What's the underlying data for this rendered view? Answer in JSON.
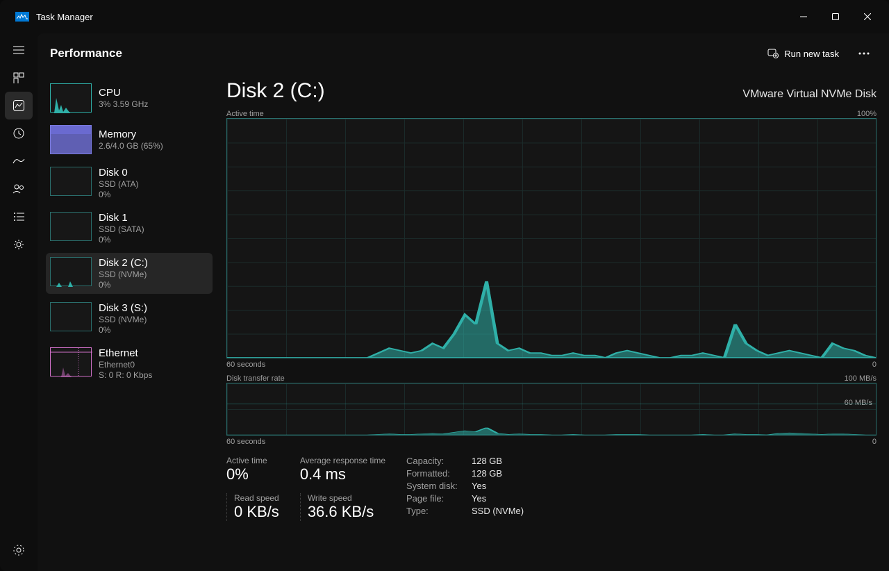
{
  "window": {
    "title": "Task Manager"
  },
  "header": {
    "page_title": "Performance",
    "run_task_label": "Run new task"
  },
  "resources": [
    {
      "title": "CPU",
      "sub1": "3%  3.59 GHz",
      "sub2": "",
      "color": "#2fb0a8",
      "thumb": "cpu"
    },
    {
      "title": "Memory",
      "sub1": "2.6/4.0 GB (65%)",
      "sub2": "",
      "color": "#7a7ae0",
      "thumb": "memory"
    },
    {
      "title": "Disk 0",
      "sub1": "SSD (ATA)",
      "sub2": "0%",
      "color": "#2a6e6c",
      "thumb": "disk"
    },
    {
      "title": "Disk 1",
      "sub1": "SSD (SATA)",
      "sub2": "0%",
      "color": "#2a6e6c",
      "thumb": "disk"
    },
    {
      "title": "Disk 2 (C:)",
      "sub1": "SSD (NVMe)",
      "sub2": "0%",
      "color": "#2a6e6c",
      "thumb": "disk2",
      "selected": true
    },
    {
      "title": "Disk 3 (S:)",
      "sub1": "SSD (NVMe)",
      "sub2": "0%",
      "color": "#2a6e6c",
      "thumb": "disk"
    },
    {
      "title": "Ethernet",
      "sub1": "Ethernet0",
      "sub2": "S: 0 R: 0 Kbps",
      "color": "#d070c8",
      "thumb": "ethernet"
    }
  ],
  "detail": {
    "title": "Disk 2 (C:)",
    "model": "VMware Virtual NVMe Disk",
    "chart1_label": "Active time",
    "chart1_max": "100%",
    "chart1_timerange": "60 seconds",
    "chart1_end": "0",
    "chart2_label": "Disk transfer rate",
    "chart2_max": "100 MB/s",
    "chart2_line": "60 MB/s",
    "stats": {
      "active_time_label": "Active time",
      "active_time_value": "0%",
      "avg_resp_label": "Average response time",
      "avg_resp_value": "0.4 ms",
      "read_label": "Read speed",
      "read_value": "0 KB/s",
      "write_label": "Write speed",
      "write_value": "36.6 KB/s"
    },
    "info": {
      "capacity_k": "Capacity:",
      "capacity_v": "128 GB",
      "formatted_k": "Formatted:",
      "formatted_v": "128 GB",
      "sysdisk_k": "System disk:",
      "sysdisk_v": "Yes",
      "pagefile_k": "Page file:",
      "pagefile_v": "Yes",
      "type_k": "Type:",
      "type_v": "SSD (NVMe)"
    }
  },
  "chart_data": [
    {
      "type": "area",
      "title": "Active time",
      "ylabel": "%",
      "ylim": [
        0,
        100
      ],
      "xlabel": "seconds",
      "xlim": [
        60,
        0
      ],
      "series": [
        {
          "name": "Active time %",
          "color": "#2fb0a8",
          "values": [
            0,
            0,
            0,
            0,
            0,
            0,
            0,
            0,
            0,
            0,
            0,
            0,
            0,
            0,
            2,
            4,
            3,
            2,
            3,
            6,
            4,
            10,
            18,
            14,
            32,
            6,
            3,
            4,
            2,
            2,
            1,
            1,
            2,
            1,
            1,
            0,
            2,
            3,
            2,
            1,
            0,
            0,
            1,
            1,
            2,
            1,
            0,
            14,
            6,
            3,
            1,
            2,
            3,
            2,
            1,
            0,
            6,
            4,
            3,
            1,
            0
          ]
        }
      ]
    },
    {
      "type": "area",
      "title": "Disk transfer rate",
      "ylabel": "MB/s",
      "ylim": [
        0,
        100
      ],
      "gridlines": [
        60
      ],
      "xlabel": "seconds",
      "xlim": [
        60,
        0
      ],
      "series": [
        {
          "name": "Write",
          "color": "#2fb0a8",
          "values": [
            0,
            0,
            0,
            0,
            0,
            0,
            0,
            0,
            0,
            0,
            0,
            0,
            0,
            0,
            1,
            2,
            1,
            1,
            2,
            3,
            2,
            5,
            8,
            6,
            14,
            3,
            1,
            2,
            1,
            1,
            0,
            0,
            1,
            0,
            0,
            0,
            1,
            1,
            1,
            0,
            0,
            0,
            0,
            0,
            1,
            0,
            0,
            2,
            1,
            1,
            0,
            3,
            4,
            3,
            2,
            1,
            2,
            2,
            1,
            0,
            0
          ]
        },
        {
          "name": "Read",
          "color": "#2fb0a8",
          "dashed": true,
          "values": [
            0,
            0,
            0,
            0,
            0,
            0,
            0,
            0,
            0,
            0,
            0,
            0,
            0,
            0,
            0,
            0,
            0,
            0,
            0,
            0,
            0,
            0,
            0,
            0,
            0,
            0,
            0,
            0,
            0,
            0,
            0,
            0,
            0,
            0,
            0,
            0,
            0,
            0,
            0,
            0,
            0,
            0,
            0,
            0,
            0,
            0,
            0,
            0,
            0,
            0,
            0,
            0,
            0,
            0,
            0,
            0,
            0,
            0,
            0,
            0,
            0
          ]
        }
      ]
    }
  ]
}
